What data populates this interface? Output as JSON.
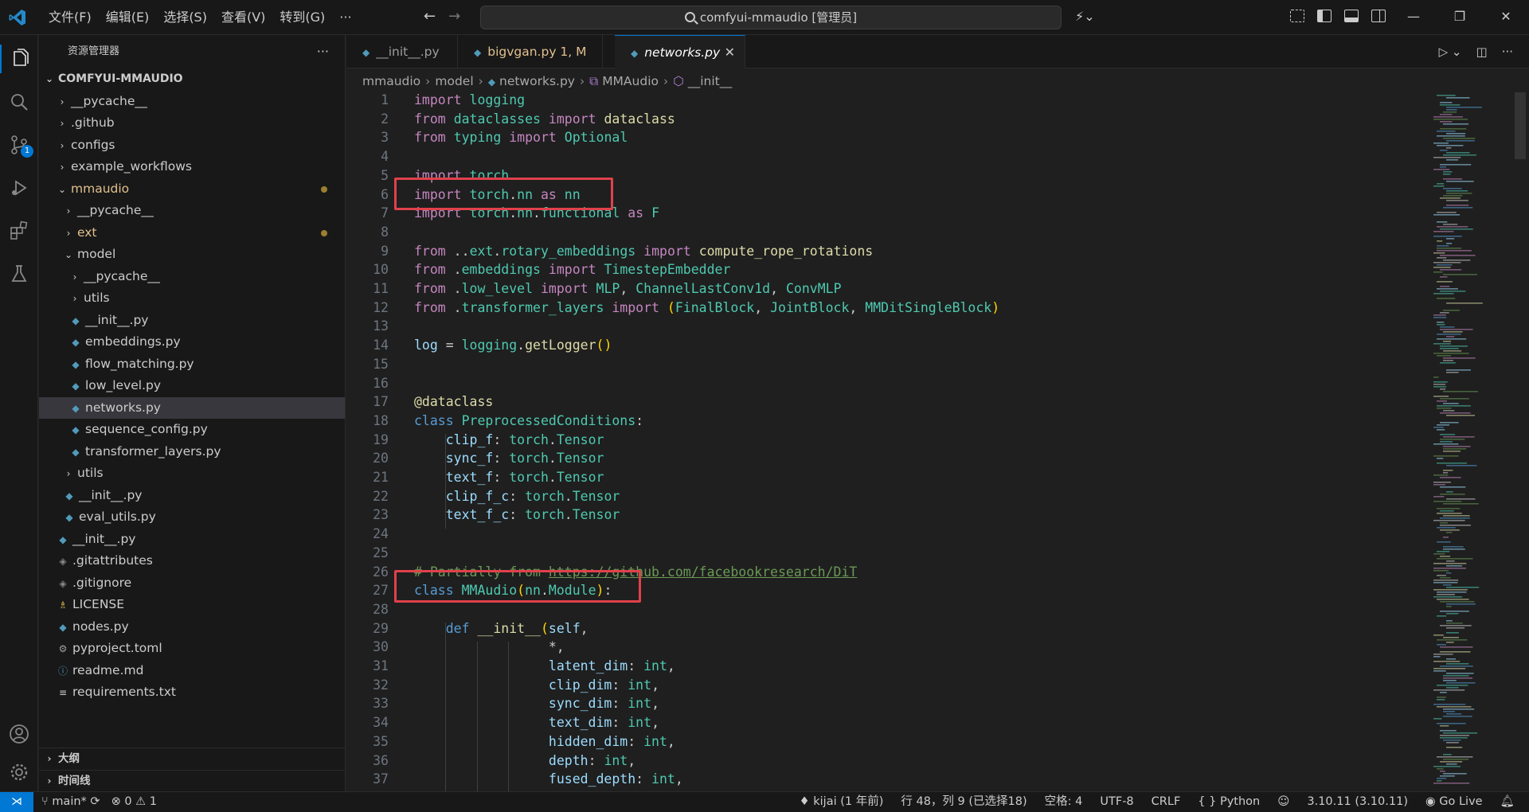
{
  "titlebar": {
    "menu": [
      "文件(F)",
      "编辑(E)",
      "选择(S)",
      "查看(V)",
      "转到(G)",
      "···"
    ],
    "search_text": "comfyui-mmaudio [管理员]"
  },
  "activity": {
    "scm_badge": "1"
  },
  "sidebar": {
    "title": "资源管理器",
    "more": "···",
    "root": "COMFYUI-MMAUDIO",
    "items": [
      {
        "label": "__pycache__",
        "type": "folder",
        "depth": 1
      },
      {
        "label": ".github",
        "type": "folder",
        "depth": 1
      },
      {
        "label": "configs",
        "type": "folder",
        "depth": 1
      },
      {
        "label": "example_workflows",
        "type": "folder",
        "depth": 1
      },
      {
        "label": "mmaudio",
        "type": "folder-open",
        "depth": 1,
        "modified": true
      },
      {
        "label": "__pycache__",
        "type": "folder",
        "depth": 2
      },
      {
        "label": "ext",
        "type": "folder",
        "depth": 2,
        "modified": true
      },
      {
        "label": "model",
        "type": "folder-open",
        "depth": 2
      },
      {
        "label": "__pycache__",
        "type": "folder",
        "depth": 3
      },
      {
        "label": "utils",
        "type": "folder",
        "depth": 3
      },
      {
        "label": "__init__.py",
        "type": "py",
        "depth": 3
      },
      {
        "label": "embeddings.py",
        "type": "py",
        "depth": 3
      },
      {
        "label": "flow_matching.py",
        "type": "py",
        "depth": 3
      },
      {
        "label": "low_level.py",
        "type": "py",
        "depth": 3
      },
      {
        "label": "networks.py",
        "type": "py",
        "depth": 3,
        "selected": true
      },
      {
        "label": "sequence_config.py",
        "type": "py",
        "depth": 3
      },
      {
        "label": "transformer_layers.py",
        "type": "py",
        "depth": 3
      },
      {
        "label": "utils",
        "type": "folder",
        "depth": 2
      },
      {
        "label": "__init__.py",
        "type": "py",
        "depth": 2
      },
      {
        "label": "eval_utils.py",
        "type": "py",
        "depth": 2
      },
      {
        "label": "__init__.py",
        "type": "py",
        "depth": 1
      },
      {
        "label": ".gitattributes",
        "type": "git",
        "depth": 1
      },
      {
        "label": ".gitignore",
        "type": "git",
        "depth": 1
      },
      {
        "label": "LICENSE",
        "type": "license",
        "depth": 1
      },
      {
        "label": "nodes.py",
        "type": "py",
        "depth": 1
      },
      {
        "label": "pyproject.toml",
        "type": "gear",
        "depth": 1
      },
      {
        "label": "readme.md",
        "type": "info",
        "depth": 1
      },
      {
        "label": "requirements.txt",
        "type": "txt",
        "depth": 1
      }
    ],
    "outline": "大纲",
    "timeline": "时间线"
  },
  "tabs": [
    {
      "label": "__init__.py",
      "state": "normal"
    },
    {
      "label": "bigvgan.py  1, M",
      "state": "modified"
    },
    {
      "label": "networks.py",
      "state": "active"
    }
  ],
  "breadcrumb": [
    "mmaudio",
    "model",
    "networks.py",
    "MMAudio",
    "__init__"
  ],
  "code_lines": [
    "1",
    "2",
    "3",
    "4",
    "5",
    "6",
    "7",
    "8",
    "9",
    "10",
    "11",
    "12",
    "13",
    "14",
    "15",
    "16",
    "17",
    "18",
    "19",
    "20",
    "21",
    "22",
    "23",
    "24",
    "25",
    "26",
    "27",
    "28",
    "29",
    "30",
    "31",
    "32",
    "33",
    "34",
    "35",
    "36",
    "37"
  ],
  "statusbar": {
    "branch": "main*",
    "problems": "⊗ 0 ⚠ 1",
    "blame": "kijai (1 年前)",
    "position": "行 48，列 9 (已选择18)",
    "indent": "空格: 4",
    "encoding": "UTF-8",
    "eol": "CRLF",
    "language": "{ } Python",
    "interpreter": "3.10.11 (3.10.11)",
    "golive": "Go Live"
  },
  "colors": {
    "accent": "#0078d4",
    "highlight_box": "#e0414b",
    "keyword": "#569cd6",
    "import_kw": "#c586c0",
    "class_name": "#4ec9b0",
    "function": "#dcdcaa",
    "variable": "#9cdcfe",
    "comment": "#6a9955"
  }
}
